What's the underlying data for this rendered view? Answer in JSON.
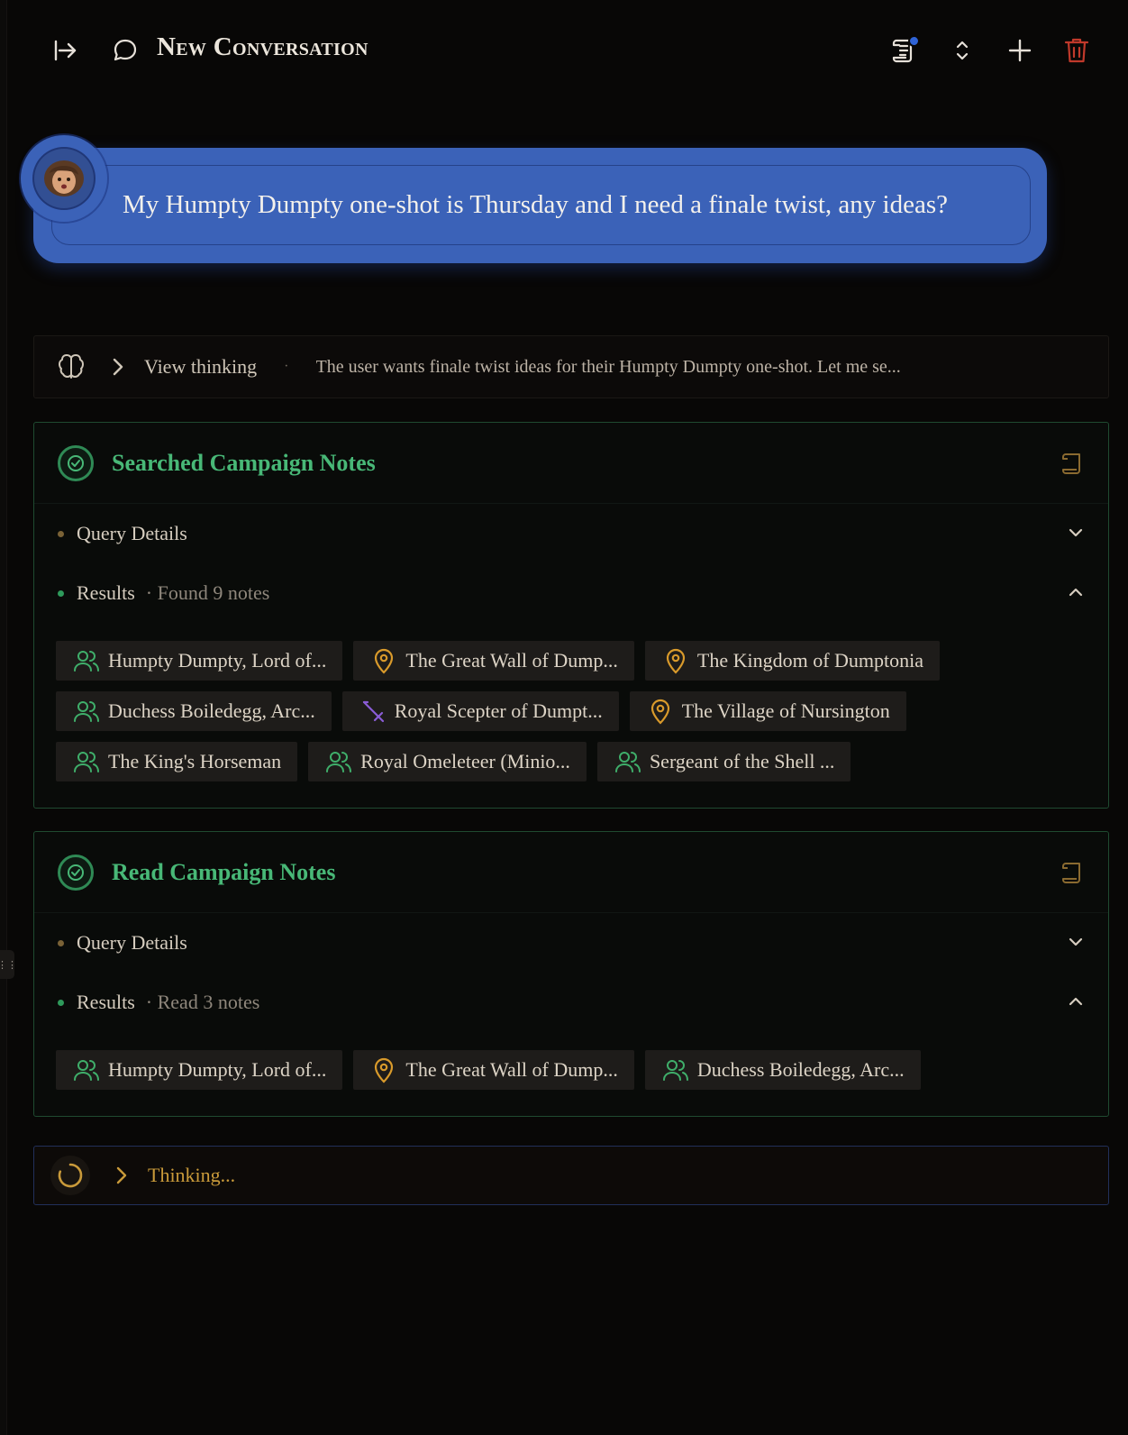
{
  "header": {
    "title": "New Conversation",
    "icons": {
      "sidebar_toggle": "expand-sidebar-icon",
      "conversation": "speech-bubble-icon",
      "notes": "scroll-notes-icon",
      "switch": "chevron-up-down-icon",
      "new": "plus-icon",
      "delete": "trash-icon"
    },
    "accent_color": "#2f63d6",
    "delete_color": "#c0392b"
  },
  "user_message": {
    "text": "My Humpty Dumpty one-shot is Thursday and I need a finale twist, any ideas?",
    "bubble_color": "#3b62b8"
  },
  "thinking": {
    "label": "View thinking",
    "separator": "·",
    "preview": "The user wants finale twist ideas for their Humpty Dumpty one-shot. Let me se..."
  },
  "search_card": {
    "title": "Searched Campaign Notes",
    "query_label": "Query Details",
    "results_label": "Results",
    "results_summary": "· Found 9 notes",
    "chips": [
      {
        "label": "Humpty Dumpty, Lord of...",
        "icon": "people-icon"
      },
      {
        "label": "The Great Wall of Dump...",
        "icon": "location-pin-icon"
      },
      {
        "label": "The Kingdom of Dumptonia",
        "icon": "location-pin-icon"
      },
      {
        "label": "Duchess Boiledegg, Arc...",
        "icon": "people-icon"
      },
      {
        "label": "Royal Scepter of Dumpt...",
        "icon": "sword-icon"
      },
      {
        "label": "The Village of Nursington",
        "icon": "location-pin-icon"
      },
      {
        "label": "The King's Horseman",
        "icon": "people-icon"
      },
      {
        "label": "Royal Omeleteer (Minio...",
        "icon": "people-icon"
      },
      {
        "label": "Sergeant of the Shell ...",
        "icon": "people-icon"
      }
    ]
  },
  "read_card": {
    "title": "Read Campaign Notes",
    "query_label": "Query Details",
    "results_label": "Results",
    "results_summary": "· Read 3 notes",
    "chips": [
      {
        "label": "Humpty Dumpty, Lord of...",
        "icon": "people-icon"
      },
      {
        "label": "The Great Wall of Dump...",
        "icon": "location-pin-icon"
      },
      {
        "label": "Duchess Boiledegg, Arc...",
        "icon": "people-icon"
      }
    ]
  },
  "thinking_live": {
    "label": "Thinking..."
  },
  "colors": {
    "success_green": "#48b877",
    "person_icon": "#3fae6a",
    "location_icon": "#d99a2b",
    "item_icon": "#8a5cd6",
    "thinking_gold": "#c99a3a"
  }
}
